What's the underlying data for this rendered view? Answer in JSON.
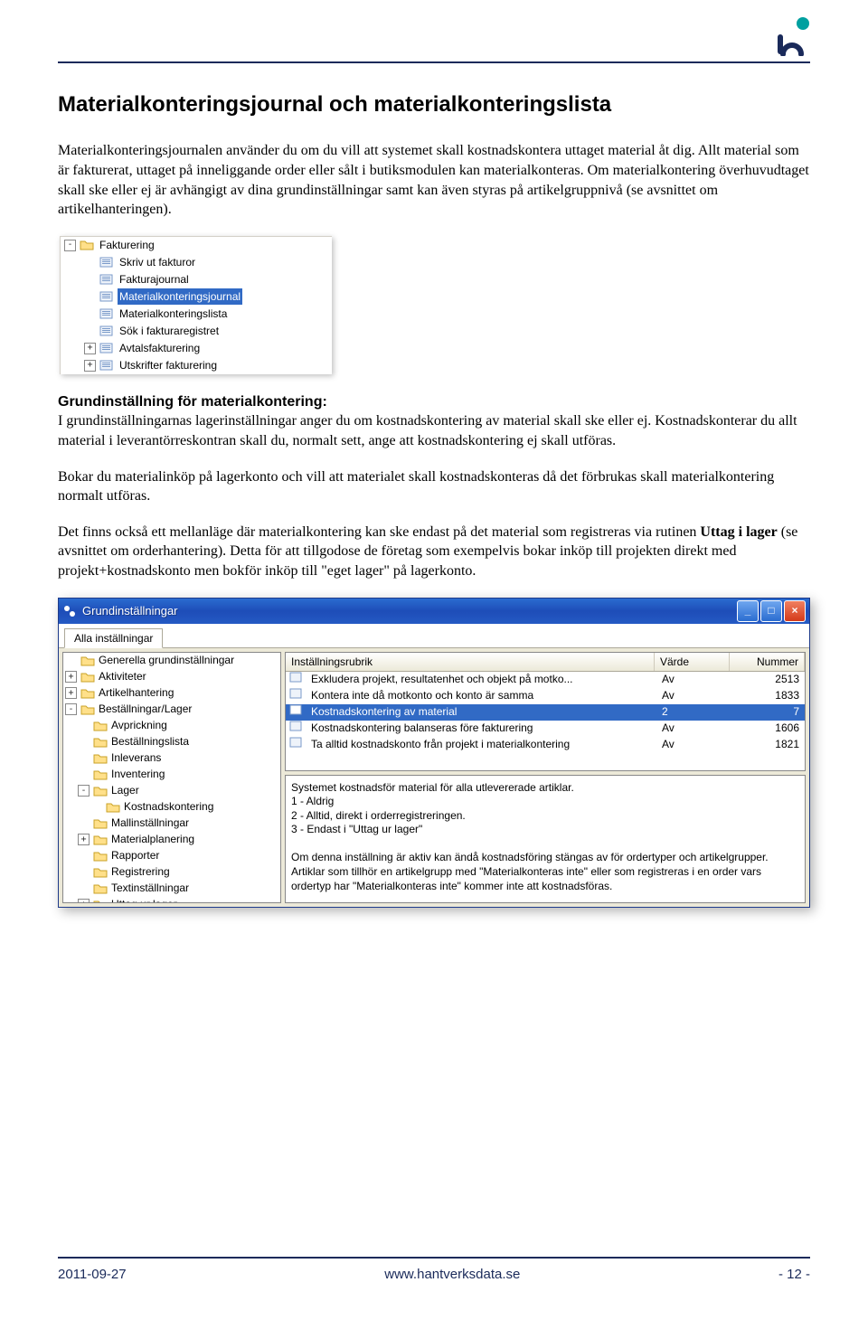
{
  "header": {
    "title": "Materialkonteringsjournal och materialkonteringslista"
  },
  "para1": "Materialkonteringsjournalen använder du om du vill att systemet skall kostnadskontera uttaget material åt dig. Allt material som är fakturerat, uttaget på inneliggande order eller sålt i butiksmodulen kan materialkonteras. Om materialkontering överhuvudtaget skall ske eller ej är avhängigt av dina grundinställningar samt kan även styras på artikelgruppnivå (se avsnittet om artikelhanteringen).",
  "tree1": {
    "root": "Fakturering",
    "items": [
      "Skriv ut fakturor",
      "Fakturajournal",
      "Materialkonteringsjournal",
      "Materialkonteringslista",
      "Sök i fakturaregistret",
      "Avtalsfakturering",
      "Utskrifter fakturering"
    ]
  },
  "sec2": {
    "head": "Grundinställning för materialkontering:",
    "p1": "I grundinställningarnas lagerinställningar anger du om kostnadskontering av material skall ske eller ej. Kostnadskonterar du allt material i leverantörreskontran skall du, normalt sett, ange att kostnadskontering ej skall utföras.",
    "p2": "Bokar du materialinköp på lagerkonto och vill att materialet skall kostnadskonteras då det förbrukas skall materialkontering normalt utföras.",
    "p3a": "Det finns också ett mellanläge där materialkontering kan ske endast på det material som registreras via rutinen ",
    "p3b": "Uttag i lager",
    "p3c": " (se avsnittet om orderhantering). Detta för att tillgodose de företag som exempelvis bokar inköp till projekten direkt med projekt+kostnadskonto men bokför inköp till \"eget lager\" på lagerkonto."
  },
  "win": {
    "title": "Grundinställningar",
    "tab": "Alla inställningar",
    "left": [
      {
        "lvl": 0,
        "pm": "",
        "ic": "fold",
        "t": "Generella grundinställningar"
      },
      {
        "lvl": 0,
        "pm": "+",
        "ic": "fold",
        "t": "Aktiviteter"
      },
      {
        "lvl": 0,
        "pm": "+",
        "ic": "fold",
        "t": "Artikelhantering"
      },
      {
        "lvl": 0,
        "pm": "-",
        "ic": "fold",
        "t": "Beställningar/Lager"
      },
      {
        "lvl": 1,
        "pm": "",
        "ic": "fold",
        "t": "Avprickning"
      },
      {
        "lvl": 1,
        "pm": "",
        "ic": "fold",
        "t": "Beställningslista"
      },
      {
        "lvl": 1,
        "pm": "",
        "ic": "fold",
        "t": "Inleverans"
      },
      {
        "lvl": 1,
        "pm": "",
        "ic": "fold",
        "t": "Inventering"
      },
      {
        "lvl": 1,
        "pm": "-",
        "ic": "fold",
        "t": "Lager"
      },
      {
        "lvl": 2,
        "pm": "",
        "ic": "fold",
        "t": "Kostnadskontering"
      },
      {
        "lvl": 1,
        "pm": "",
        "ic": "fold",
        "t": "Mallinställningar"
      },
      {
        "lvl": 1,
        "pm": "+",
        "ic": "fold",
        "t": "Materialplanering"
      },
      {
        "lvl": 1,
        "pm": "",
        "ic": "fold",
        "t": "Rapporter"
      },
      {
        "lvl": 1,
        "pm": "",
        "ic": "fold",
        "t": "Registrering"
      },
      {
        "lvl": 1,
        "pm": "",
        "ic": "fold",
        "t": "Textinställningar"
      },
      {
        "lvl": 1,
        "pm": "+",
        "ic": "fold",
        "t": "Uttag ur lager"
      }
    ],
    "cols": {
      "c1": "Inställningsrubrik",
      "c2": "Värde",
      "c3": "Nummer"
    },
    "rows": [
      {
        "t": "Exkludera projekt, resultatenhet och objekt på motko...",
        "v": "Av",
        "n": "2513"
      },
      {
        "t": "Kontera inte då motkonto och konto är samma",
        "v": "Av",
        "n": "1833"
      },
      {
        "t": "Kostnadskontering av material",
        "v": "2",
        "n": "7",
        "sel": true
      },
      {
        "t": "Kostnadskontering balanseras före fakturering",
        "v": "Av",
        "n": "1606"
      },
      {
        "t": "Ta alltid kostnadskonto från projekt i materialkontering",
        "v": "Av",
        "n": "1821"
      }
    ],
    "desc": "Systemet kostnadsför material för alla utlevererade artiklar.\n1 - Aldrig\n2 - Alltid, direkt i orderregistreringen.\n3 - Endast i \"Uttag ur lager\"\n\nOm denna inställning är aktiv kan ändå kostnadsföring stängas av för ordertyper och artikelgrupper. Artiklar som tillhör en artikelgrupp med \"Materialkonteras inte\" eller som registreras i en order vars ordertyp har \"Materialkonteras inte\" kommer inte att kostnadsföras."
  },
  "footer": {
    "date": "2011-09-27",
    "url": "www.hantverksdata.se",
    "page": "- 12 -"
  }
}
